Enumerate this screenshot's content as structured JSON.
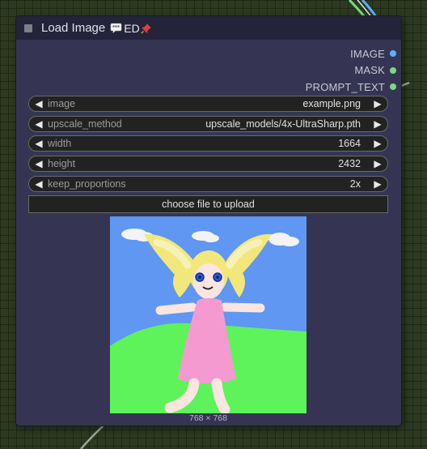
{
  "canvas": {
    "background": "#2c3a21"
  },
  "node": {
    "title": "Load Image",
    "badges": [
      {
        "icon": "speech-bubble-icon"
      },
      {
        "text": "ED"
      },
      {
        "icon": "pushpin-icon"
      }
    ],
    "badge_text": "ED",
    "outputs": [
      {
        "label": "IMAGE",
        "color": "#5fb0ff"
      },
      {
        "label": "MASK",
        "color": "#7bd88a"
      },
      {
        "label": "PROMPT_TEXT",
        "color": "#7bd88a"
      }
    ],
    "widgets": [
      {
        "label": "image",
        "value": "example.png"
      },
      {
        "label": "upscale_method",
        "value": "upscale_models/4x-UltraSharp.pth"
      },
      {
        "label": "width",
        "value": "1664"
      },
      {
        "label": "height",
        "value": "2432"
      },
      {
        "label": "keep_proportions",
        "value": "2x"
      }
    ],
    "upload_button": "choose file to upload",
    "preview_caption": "768 × 768"
  },
  "colors": {
    "node_body": "#353553",
    "node_title": "#23233a",
    "widget_bg": "#222222",
    "image_output": "#5fb0ff",
    "mask_output": "#7bd88a"
  }
}
